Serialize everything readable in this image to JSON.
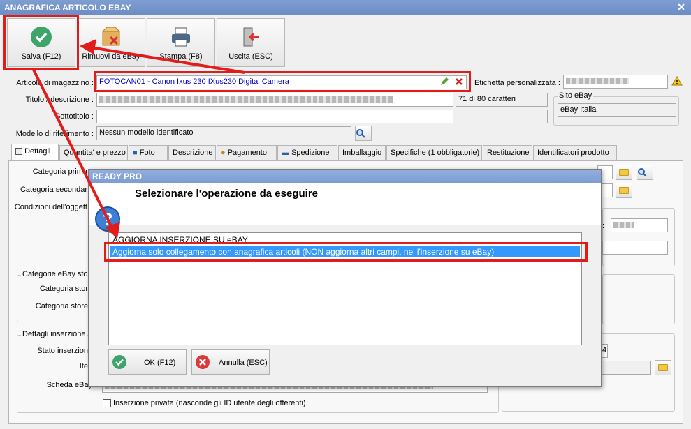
{
  "window": {
    "title": "ANAGRAFICA ARTICOLO EBAY",
    "close_glyph": "✕"
  },
  "toolbar": {
    "save": "Salva (F12)",
    "remove": "Rimuovi da eBay",
    "print": "Stampa (F8)",
    "exit": "Uscita (ESC)"
  },
  "form": {
    "articolo_label": "Articolo di magazzino :",
    "articolo_value": "FOTOCAN01 - Canon Ixus 230 IXus230 Digital Camera",
    "etichetta_label": "Etichetta personalizzata :",
    "titolo_label": "Titolo / descrizione :",
    "titolo_counter": "71 di 80 caratteri",
    "sottotitolo_label": "Sottotitolo :",
    "modello_label": "Modello di riferimento :",
    "modello_value": "Nessun modello identificato",
    "sito_label": "Sito eBay",
    "sito_value": "eBay Italia"
  },
  "tabs": [
    {
      "label": "Dettagli"
    },
    {
      "label": "Quantita' e prezzo"
    },
    {
      "label": "Foto"
    },
    {
      "label": "Descrizione"
    },
    {
      "label": "Pagamento"
    },
    {
      "label": "Spedizione"
    },
    {
      "label": "Imballaggio"
    },
    {
      "label": "Specifiche (1 obbligatorie)"
    },
    {
      "label": "Restituzione"
    },
    {
      "label": "Identificatori prodotto"
    }
  ],
  "details": {
    "categoria_primaria": "Categoria prima",
    "categoria_secondaria": "Categoria secondar",
    "condizioni": "Condizioni dell'oggett",
    "categorie_store_group": "Categorie eBay stor",
    "categoria_store1": "Categoria stor",
    "categoria_store2": "Categoria store",
    "dettagli_group": "Dettagli inserzione",
    "stato_inserzione": "Stato inserzion",
    "item": "Ite",
    "scheda": "Scheda eBay",
    "privata": "Inserzione privata (nasconde gli ID utente degli offerenti)",
    "right_field_fragment": "4"
  },
  "dialog": {
    "title": "READY PRO",
    "question": "Selezionare l'operazione da eseguire",
    "options": [
      "AGGIORNA INSERZIONE SU eBAY",
      "Aggiorna solo collegamento con anagrafica articoli (NON aggiorna altri campi, ne' l'inserzione su eBay)"
    ],
    "ok": "OK (F12)",
    "cancel": "Annulla (ESC)"
  },
  "icons": {
    "save": "check-circle-icon",
    "remove": "box-remove-icon",
    "print": "printer-icon",
    "exit": "exit-door-icon",
    "help": "question-icon",
    "warning": "warning-icon"
  },
  "colors": {
    "annotation": "#e21b1b",
    "selection": "#3399ff",
    "link_text": "#0000cc"
  }
}
